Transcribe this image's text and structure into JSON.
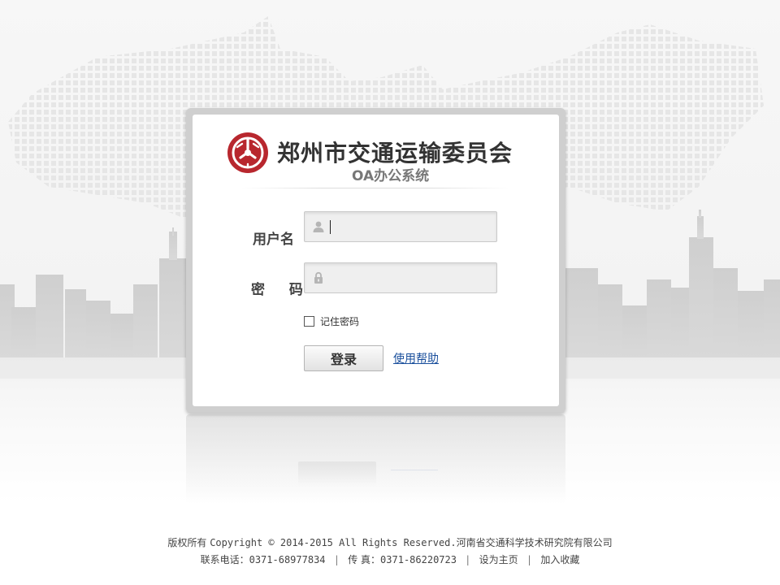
{
  "header": {
    "org_name": "郑州市交通运输委员会",
    "subtitle": "OA办公系统"
  },
  "form": {
    "username_label": "用户名",
    "password_label": "密 码",
    "username_value": "",
    "password_value": "",
    "remember_label": "记住密码",
    "remember_checked": false,
    "login_label": "登录",
    "help_label": "使用帮助"
  },
  "footer": {
    "copyright_prefix": "版权所有",
    "copyright_text": "Copyright © 2014-2015 All Rights Reserved.",
    "company": "河南省交通科学技术研究院有限公司",
    "phone_label": "联系电话：",
    "phone": "0371-68977834",
    "fax_label": "传 真：",
    "fax": "0371-86220723",
    "set_home_label": "设为主页",
    "favorite_label": "加入收藏",
    "separator": "|"
  },
  "colors": {
    "logo_red": "#b8272e",
    "link_blue": "#1a4f9c",
    "panel_border": "#cfcfcf"
  },
  "icons": {
    "username_field": "user-icon",
    "password_field": "lock-icon",
    "brand": "logo-emblem"
  }
}
